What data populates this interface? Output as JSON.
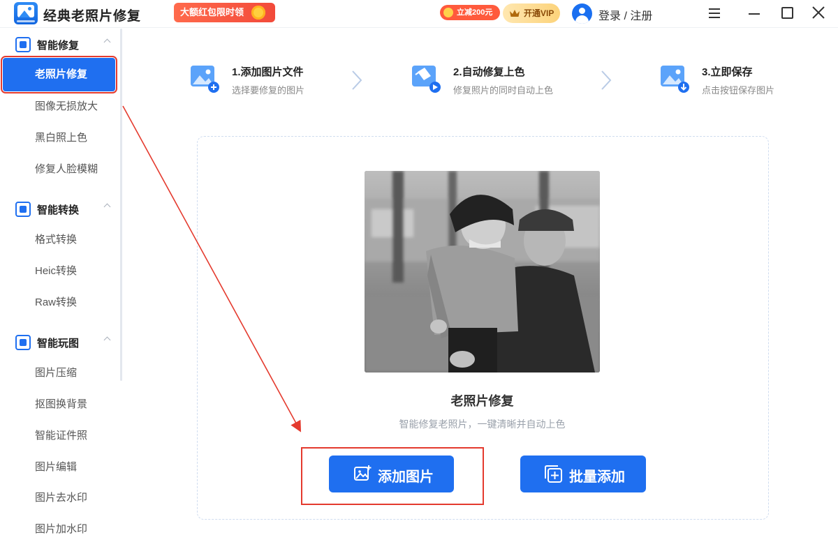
{
  "app": {
    "title": "经典老照片修复",
    "promo_label": "大额红包限时领",
    "discount_badge": "立减200元",
    "vip_label": "开通VIP",
    "login_label": "登录 / 注册"
  },
  "sidebar": {
    "groups": [
      {
        "label": "智能修复",
        "icon": "image-repair-icon",
        "items": [
          {
            "label": "老照片修复",
            "active": true
          },
          {
            "label": "图像无损放大"
          },
          {
            "label": "黑白照上色"
          },
          {
            "label": "修复人脸模糊"
          }
        ]
      },
      {
        "label": "智能转换",
        "icon": "convert-icon",
        "items": [
          {
            "label": "格式转换"
          },
          {
            "label": "Heic转换"
          },
          {
            "label": "Raw转换"
          }
        ]
      },
      {
        "label": "智能玩图",
        "icon": "play-image-icon",
        "items": [
          {
            "label": "图片压缩"
          },
          {
            "label": "抠图换背景"
          },
          {
            "label": "智能证件照"
          },
          {
            "label": "图片编辑"
          },
          {
            "label": "图片去水印"
          },
          {
            "label": "图片加水印"
          }
        ]
      }
    ]
  },
  "steps": [
    {
      "title": "1.添加图片文件",
      "desc": "选择要修复的图片",
      "icon": "add-image-icon"
    },
    {
      "title": "2.自动修复上色",
      "desc": "修复照片的同时自动上色",
      "icon": "paint-bucket-icon"
    },
    {
      "title": "3.立即保存",
      "desc": "点击按钮保存图片",
      "icon": "save-image-icon"
    }
  ],
  "card": {
    "title": "老照片修复",
    "subtitle": "智能修复老照片，一键清晰并自动上色"
  },
  "buttons": {
    "add_image": "添加图片",
    "batch_add": "批量添加"
  },
  "colors": {
    "accent": "#1f6ff0",
    "annotation": "#e43a2e",
    "promo": "#f24a3a",
    "vip": "#fcd37b"
  }
}
